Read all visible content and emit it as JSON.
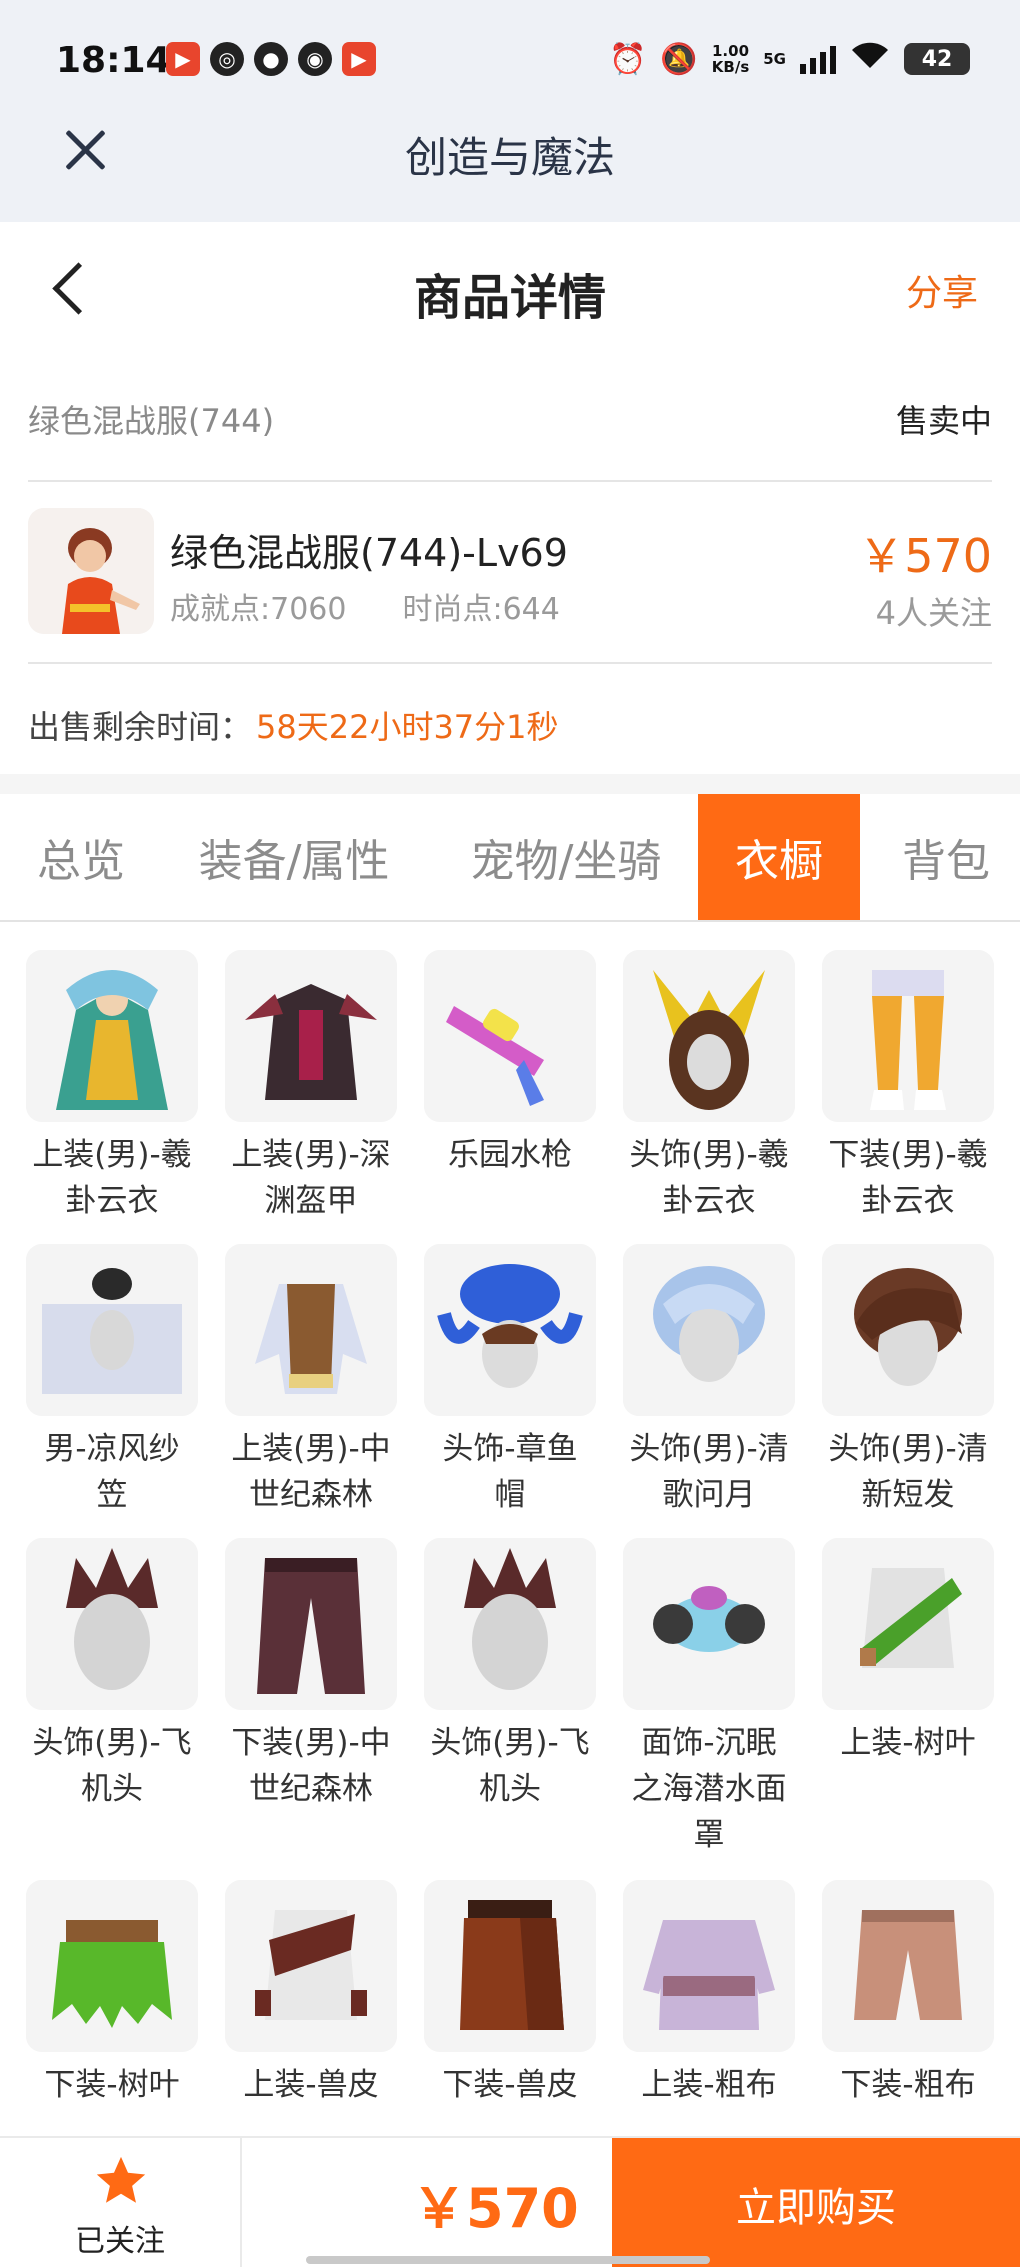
{
  "status_bar": {
    "time": "18:14",
    "left_icons": [
      "ting-app-icon",
      "weibo-icon",
      "wechat-icon",
      "messenger-icon",
      "ting-app-icon"
    ],
    "speed_top": "1.00",
    "speed_bottom": "KB/s",
    "network": "5G",
    "battery": "42"
  },
  "appbar": {
    "title": "创造与魔法",
    "close_icon": "close-icon"
  },
  "header": {
    "title": "商品详情",
    "share": "分享"
  },
  "product": {
    "item_name": "绿色混战服(744)",
    "status": "售卖中",
    "title": "绿色混战服(744)-Lv69",
    "achievement": "成就点:7060",
    "fashion": "时尚点:644",
    "price": "￥570",
    "followers": "4人关注",
    "time_label": "出售剩余时间：",
    "time_value": "58天22小时37分1秒"
  },
  "tabs": [
    {
      "label": "总览",
      "active": false
    },
    {
      "label": "装备/属性",
      "active": false
    },
    {
      "label": "宠物/坐骑",
      "active": false
    },
    {
      "label": "衣橱",
      "active": true
    },
    {
      "label": "背包",
      "active": false
    }
  ],
  "wardrobe": [
    {
      "label": "上装(男)-羲卦云衣",
      "line1": "上装(男)-羲",
      "line2": "卦云衣",
      "line3": ""
    },
    {
      "label": "上装(男)-深渊盔甲",
      "line1": "上装(男)-深",
      "line2": "渊盔甲",
      "line3": ""
    },
    {
      "label": "乐园水枪",
      "line1": "乐园水枪",
      "line2": "",
      "line3": ""
    },
    {
      "label": "头饰(男)-羲卦云衣",
      "line1": "头饰(男)-羲",
      "line2": "卦云衣",
      "line3": ""
    },
    {
      "label": "下装(男)-羲卦云衣",
      "line1": "下装(男)-羲",
      "line2": "卦云衣",
      "line3": ""
    },
    {
      "label": "男-凉风纱笠",
      "line1": "男-凉风纱",
      "line2": "笠",
      "line3": ""
    },
    {
      "label": "上装(男)-中世纪森林",
      "line1": "上装(男)-中",
      "line2": "世纪森林",
      "line3": ""
    },
    {
      "label": "头饰-章鱼帽",
      "line1": "头饰-章鱼",
      "line2": "帽",
      "line3": ""
    },
    {
      "label": "头饰(男)-清歌问月",
      "line1": "头饰(男)-清",
      "line2": "歌问月",
      "line3": ""
    },
    {
      "label": "头饰(男)-清新短发",
      "line1": "头饰(男)-清",
      "line2": "新短发",
      "line3": ""
    },
    {
      "label": "头饰(男)-飞机头",
      "line1": "头饰(男)-飞",
      "line2": "机头",
      "line3": ""
    },
    {
      "label": "下装(男)-中世纪森林",
      "line1": "下装(男)-中",
      "line2": "世纪森林",
      "line3": ""
    },
    {
      "label": "头饰(男)-飞机头",
      "line1": "头饰(男)-飞",
      "line2": "机头",
      "line3": ""
    },
    {
      "label": "面饰-沉眠之海潜水面罩",
      "line1": "面饰-沉眠",
      "line2": "之海潜水面",
      "line3": "罩"
    },
    {
      "label": "上装-树叶",
      "line1": "上装-树叶",
      "line2": "",
      "line3": ""
    },
    {
      "label": "下装-树叶",
      "line1": "下装-树叶",
      "line2": "",
      "line3": ""
    },
    {
      "label": "上装-兽皮",
      "line1": "上装-兽皮",
      "line2": "",
      "line3": ""
    },
    {
      "label": "下装-兽皮",
      "line1": "下装-兽皮",
      "line2": "",
      "line3": ""
    },
    {
      "label": "上装-粗布",
      "line1": "上装-粗布",
      "line2": "",
      "line3": ""
    },
    {
      "label": "下装-粗布",
      "line1": "下装-粗布",
      "line2": "",
      "line3": ""
    }
  ],
  "bottom": {
    "follow_label": "已关注",
    "price": "￥570",
    "buy_label": "立即购买"
  },
  "colors": {
    "accent": "#ff6a14",
    "accent_text": "#ee6a17",
    "muted": "#9a9a9a"
  }
}
